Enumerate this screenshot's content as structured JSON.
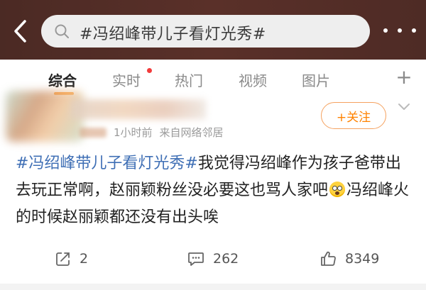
{
  "header": {
    "search_query": "#冯绍峰带儿子看灯光秀#"
  },
  "tabs": [
    {
      "label": "综合",
      "active": true
    },
    {
      "label": "实时",
      "active": false
    },
    {
      "label": "热门",
      "active": false
    },
    {
      "label": "视频",
      "active": false
    },
    {
      "label": "图片",
      "active": false
    }
  ],
  "post": {
    "time": "1小时前",
    "source": "来自网络邻居",
    "follow_label": "+关注",
    "topic": "#冯绍峰带儿子看灯光秀#",
    "text_part1": "我觉得冯绍峰作为孩子爸带出去玩正常啊，赵丽颖粉丝没必要这也骂人家吧",
    "text_part2": "冯绍峰火的时候赵丽颖都还没有出头唉"
  },
  "actions": {
    "repost_count": "2",
    "comment_count": "262",
    "like_count": "8349"
  },
  "colors": {
    "header_bg": "#4b2a24",
    "accent": "#ff8200",
    "topic_link": "#3f6fb5"
  }
}
